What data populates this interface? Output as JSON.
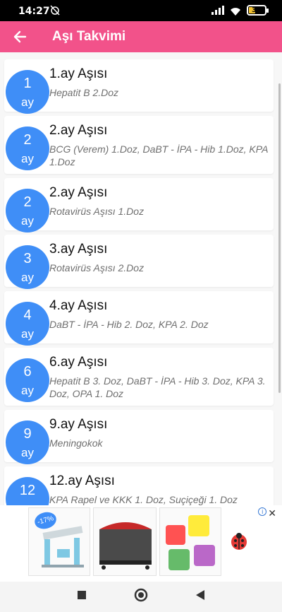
{
  "status_bar": {
    "time": "14:27",
    "battery": "38"
  },
  "header": {
    "title": "Aşı Takvimi",
    "color": "#f2528a"
  },
  "vaccines": [
    {
      "month": "1",
      "unit": "ay",
      "title": "1.ay Aşısı",
      "desc": "Hepatit B 2.Doz"
    },
    {
      "month": "2",
      "unit": "ay",
      "title": "2.ay Aşısı",
      "desc": "BCG (Verem) 1.Doz, DaBT - İPA - Hib 1.Doz, KPA 1.Doz"
    },
    {
      "month": "2",
      "unit": "ay",
      "title": "2.ay Aşısı",
      "desc": "Rotavirüs Aşısı 1.Doz"
    },
    {
      "month": "3",
      "unit": "ay",
      "title": "3.ay Aşısı",
      "desc": "Rotavirüs Aşısı 2.Doz"
    },
    {
      "month": "4",
      "unit": "ay",
      "title": "4.ay Aşısı",
      "desc": "DaBT - İPA - Hib 2. Doz, KPA 2. Doz"
    },
    {
      "month": "6",
      "unit": "ay",
      "title": "6.ay Aşısı",
      "desc": "Hepatit B 3. Doz, DaBT - İPA - Hib 3. Doz, KPA 3. Doz, OPA 1. Doz"
    },
    {
      "month": "9",
      "unit": "ay",
      "title": "9.ay Aşısı",
      "desc": "Meningokok"
    },
    {
      "month": "12",
      "unit": "ay",
      "title": "12.ay Aşısı",
      "desc": "KPA Rapel ve KKK 1. Doz, Suçiçeği 1. Doz"
    }
  ],
  "ad": {
    "discount": "-17%"
  },
  "colors": {
    "accent": "#3f8ef7"
  }
}
